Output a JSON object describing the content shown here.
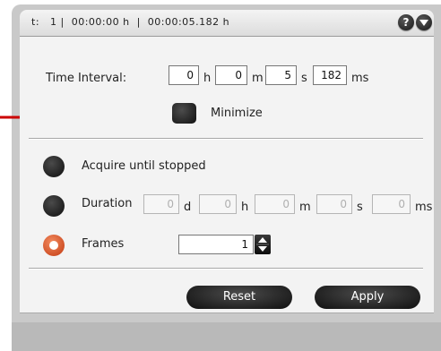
{
  "header": {
    "status_text": "t:   1 |  00:00:00 h  |  00:00:05.182 h",
    "help_icon_label": "?"
  },
  "time_interval": {
    "label": "Time Interval:",
    "hours": "0",
    "hours_unit": "h",
    "minutes": "0",
    "minutes_unit": "m",
    "seconds": "5",
    "seconds_unit": "s",
    "milliseconds": "182",
    "milliseconds_unit": "ms"
  },
  "minimize": {
    "label": "Minimize"
  },
  "mode": {
    "acquire_label": "Acquire until stopped",
    "duration_label": "Duration",
    "duration_days": "0",
    "duration_days_unit": "d",
    "duration_hours": "0",
    "duration_hours_unit": "h",
    "duration_minutes": "0",
    "duration_minutes_unit": "m",
    "duration_seconds": "0",
    "duration_seconds_unit": "s",
    "duration_ms": "0",
    "duration_ms_unit": "ms",
    "frames_label": "Frames",
    "frames_value": "1",
    "selected": "frames"
  },
  "actions": {
    "reset_label": "Reset",
    "apply_label": "Apply"
  },
  "colors": {
    "accent": "#cc0000",
    "selected_radio": "#e06a3a",
    "control_dark": "#1a1a1a"
  }
}
